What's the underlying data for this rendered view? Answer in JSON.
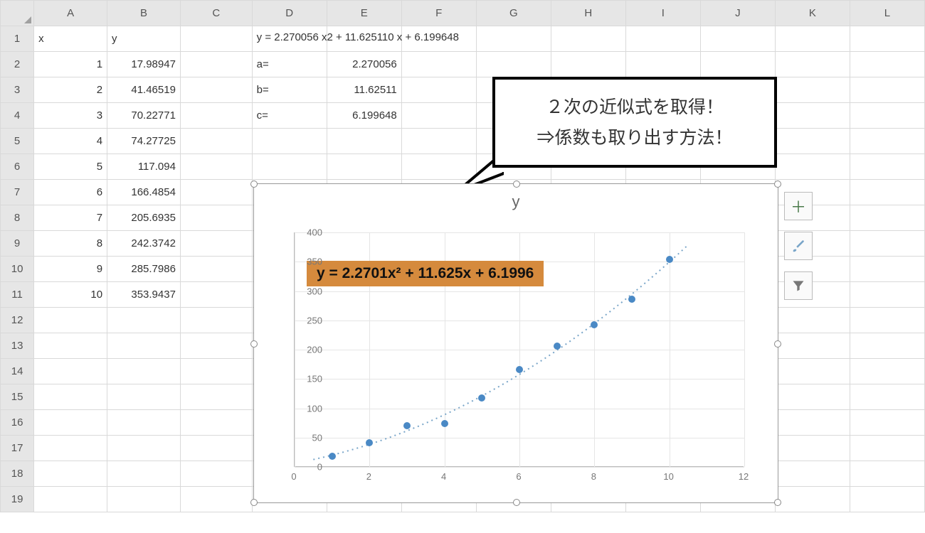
{
  "columns": [
    "A",
    "B",
    "C",
    "D",
    "E",
    "F",
    "G",
    "H",
    "I",
    "J",
    "K",
    "L"
  ],
  "row_count": 19,
  "headers": {
    "A1": "x",
    "B1": "y"
  },
  "table": {
    "x": [
      1,
      2,
      3,
      4,
      5,
      6,
      7,
      8,
      9,
      10
    ],
    "y": [
      "17.98947",
      "41.46519",
      "70.22771",
      "74.27725",
      "117.094",
      "166.4854",
      "205.6935",
      "242.3742",
      "285.7986",
      "353.9437"
    ]
  },
  "formula_text": "y = 2.270056 x2 + 11.625110 x + 6.199648",
  "coefs": {
    "a_label": "a=",
    "a": "2.270056",
    "b_label": "b=",
    "b": "11.62511",
    "c_label": "c=",
    "c": "6.199648"
  },
  "callout": {
    "line1": "２次の近似式を取得！",
    "line2": "⇒係数も取り出す方法！"
  },
  "chart_data": {
    "type": "scatter",
    "title": "y",
    "x": [
      1,
      2,
      3,
      4,
      5,
      6,
      7,
      8,
      9,
      10
    ],
    "y": [
      17.99,
      41.47,
      70.23,
      74.28,
      117.09,
      166.49,
      205.69,
      242.37,
      285.8,
      353.94
    ],
    "xlabel": "",
    "ylabel": "",
    "xlim": [
      0,
      12
    ],
    "ylim": [
      0,
      400
    ],
    "xticks": [
      0,
      2,
      4,
      6,
      8,
      10,
      12
    ],
    "yticks": [
      0,
      50,
      100,
      150,
      200,
      250,
      300,
      350,
      400
    ],
    "trendline": {
      "type": "polynomial",
      "order": 2,
      "a": 2.2701,
      "b": 11.625,
      "c": 6.1996
    },
    "equation_label": "y = 2.2701x² + 11.625x + 6.1996",
    "equation_bg": "#d58a3d",
    "marker_color": "#4a89c5"
  },
  "side_buttons": {
    "add": "＋",
    "brush": "brush-icon",
    "filter": "filter-icon"
  }
}
